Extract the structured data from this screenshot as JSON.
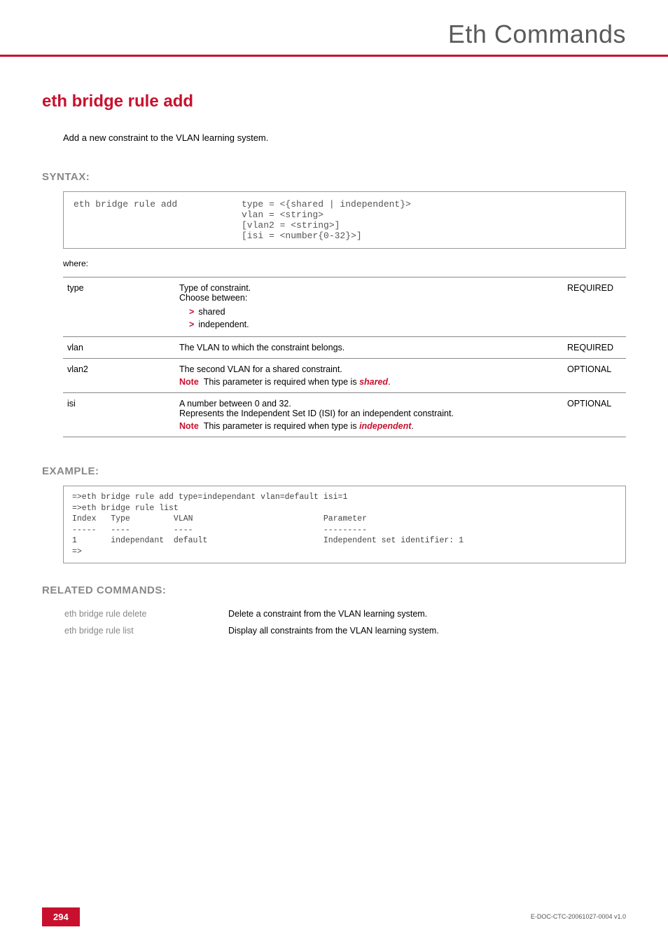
{
  "header": {
    "title": "Eth Commands"
  },
  "command": {
    "title": "eth bridge rule add",
    "description": "Add a new constraint to the VLAN learning system."
  },
  "syntax": {
    "label": "SYNTAX:",
    "command": "eth bridge rule add",
    "args": "type = <{shared | independent}>\nvlan = <string>\n[vlan2 = <string>]\n[isi = <number{0-32}>]",
    "where": "where:"
  },
  "params": [
    {
      "name": "type",
      "desc_intro": "Type of constraint.",
      "desc_sub": "Choose between:",
      "bullets": [
        "shared",
        "independent."
      ],
      "req": "REQUIRED"
    },
    {
      "name": "vlan",
      "desc_intro": "The VLAN to which the constraint belongs.",
      "req": "REQUIRED"
    },
    {
      "name": "vlan2",
      "desc_intro": "The second VLAN for a shared constraint.",
      "note_prefix": "Note",
      "note_text_a": "This parameter is required when type is ",
      "note_em": "shared",
      "note_text_b": ".",
      "req": "OPTIONAL"
    },
    {
      "name": "isi",
      "desc_intro": "A number between 0 and 32.",
      "desc_sub": "Represents the Independent Set ID (ISI) for an independent constraint.",
      "note_prefix": "Note",
      "note_text_a": "This parameter is required when type is ",
      "note_em": "independent",
      "note_text_b": ".",
      "req": "OPTIONAL"
    }
  ],
  "example": {
    "label": "EXAMPLE:",
    "text": "=>eth bridge rule add type=independant vlan=default isi=1\n=>eth bridge rule list\nIndex   Type         VLAN                           Parameter\n-----   ----         ----                           ---------\n1       independant  default                        Independent set identifier: 1\n=>"
  },
  "related": {
    "label": "RELATED COMMANDS:",
    "rows": [
      {
        "cmd": "eth bridge rule delete",
        "desc": "Delete a constraint from the VLAN learning system."
      },
      {
        "cmd": "eth bridge rule list",
        "desc": "Display all constraints from the VLAN learning system."
      }
    ]
  },
  "footer": {
    "page": "294",
    "docid": "E-DOC-CTC-20061027-0004 v1.0"
  }
}
